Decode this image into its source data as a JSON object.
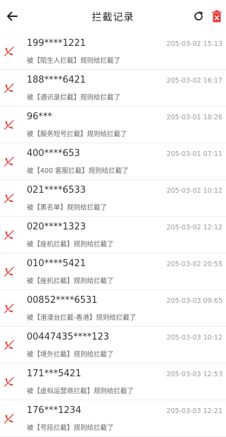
{
  "header": {
    "title": "拦截记录",
    "back_icon": "arrow-left-icon",
    "refresh_icon": "refresh-icon",
    "delete_icon": "trash-icon"
  },
  "colors": {
    "accent_red": "#e53935",
    "text_dark": "#333333",
    "text_muted": "#999999"
  },
  "records": [
    {
      "number": "199****1221",
      "time": "205-03-02 15:13",
      "desc": "被【陌生人拦截】规则给拦截了"
    },
    {
      "number": "188****6421",
      "time": "205-03-02 16:17",
      "desc": "被【通讯录拦截】规则给拦截了"
    },
    {
      "number": "96***",
      "time": "205-03-01 18:26",
      "desc": "被【服务短号拦截】规则给拦截了"
    },
    {
      "number": "400****653",
      "time": "205-03-01 07:11",
      "desc": "被【400 客服拦截】规则给拦截了"
    },
    {
      "number": "021****6533",
      "time": "205-03-02 10:12",
      "desc": "被【黑名单】规则给拦截了"
    },
    {
      "number": "020****1323",
      "time": "205-03-02 12:12",
      "desc": "被【座机拦截】规则给拦截了"
    },
    {
      "number": "010****5421",
      "time": "205-03-02 20:55",
      "desc": "被【座机拦截】规则给拦截了"
    },
    {
      "number": "00852****6531",
      "time": "205-03-03 09:65",
      "desc": "被【港澳台拦截-香港】规则给拦截了"
    },
    {
      "number": "00447435****123",
      "time": "205-03-03 10:12",
      "desc": "被【境外拦截】规则给拦截了"
    },
    {
      "number": "171***5421",
      "time": "205-03-03 12:53",
      "desc": "被【虚拟运营商拦截】规则给拦截了"
    },
    {
      "number": "176***1234",
      "time": "205-03-03 12:21",
      "desc": "被【号段拦截】规则给拦截了"
    }
  ]
}
